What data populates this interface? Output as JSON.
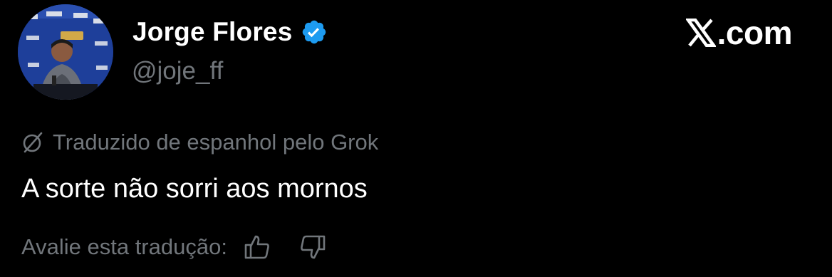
{
  "author": {
    "display_name": "Jorge Flores",
    "handle": "@joje_ff",
    "verified": true,
    "verified_color": "#1d9bf0"
  },
  "brand": {
    "logo_icon": "x-logo-icon",
    "text": ".com"
  },
  "translation": {
    "icon": "grok-icon",
    "label": "Traduzido de espanhol pelo Grok"
  },
  "tweet": {
    "text": "A sorte não sorri aos mornos"
  },
  "rating": {
    "label": "Avalie esta tradução:",
    "like_icon": "thumbs-up-icon",
    "dislike_icon": "thumbs-down-icon"
  },
  "colors": {
    "background": "#000000",
    "primary_text": "#ffffff",
    "secondary_text": "#71767b",
    "verified": "#1d9bf0"
  }
}
